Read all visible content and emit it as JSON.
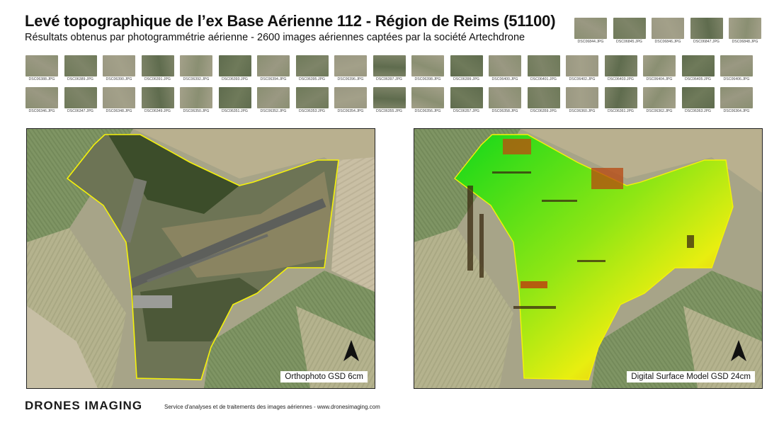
{
  "header": {
    "title": "Levé topographique de l’ex Base Aérienne 112 - Région de Reims (51100)",
    "subtitle": "Résultats obtenus par photogrammétrie aérienne - 2600 images aériennes captées par la société Artechdrone"
  },
  "thumbnails": {
    "top_right": [
      "DSC06844.JPG",
      "DSC06845.JPG",
      "DSC06846.JPG",
      "DSC06847.JPG",
      "DSC06848.JPG"
    ],
    "row1": [
      "DSC06388.JPG",
      "DSC06389.JPG",
      "DSC06390.JPG",
      "DSC06391.JPG",
      "DSC06392.JPG",
      "DSC06393.JPG",
      "DSC06394.JPG",
      "DSC06395.JPG",
      "DSC06396.JPG",
      "DSC06397.JPG",
      "DSC06398.JPG",
      "DSC06399.JPG",
      "DSC06400.JPG",
      "DSC06401.JPG",
      "DSC06402.JPG",
      "DSC06403.JPG",
      "DSC06404.JPG",
      "DSC06405.JPG",
      "DSC06406.JPG"
    ],
    "row2": [
      "DSC06346.JPG",
      "DSC06347.JPG",
      "DSC06348.JPG",
      "DSC06349.JPG",
      "DSC06350.JPG",
      "DSC06351.JPG",
      "DSC06352.JPG",
      "DSC06353.JPG",
      "DSC06354.JPG",
      "DSC06355.JPG",
      "DSC06356.JPG",
      "DSC06357.JPG",
      "DSC06358.JPG",
      "DSC06359.JPG",
      "DSC06360.JPG",
      "DSC06361.JPG",
      "DSC06362.JPG",
      "DSC06363.JPG",
      "DSC06364.JPG"
    ]
  },
  "panels": {
    "ortho_caption": "Orthophoto GSD 6cm",
    "dsm_caption": "Digital Surface Model GSD 24cm"
  },
  "footer": {
    "logo": "DRONES IMAGING",
    "tagline": "Service d'analyses et de traitements des images aériennes - www.dronesimaging.com"
  },
  "colors": {
    "boundary": "#f5f20a",
    "dsm_low": "#12d81a",
    "dsm_mid": "#e8ee10",
    "dsm_high": "#f07a1a"
  }
}
